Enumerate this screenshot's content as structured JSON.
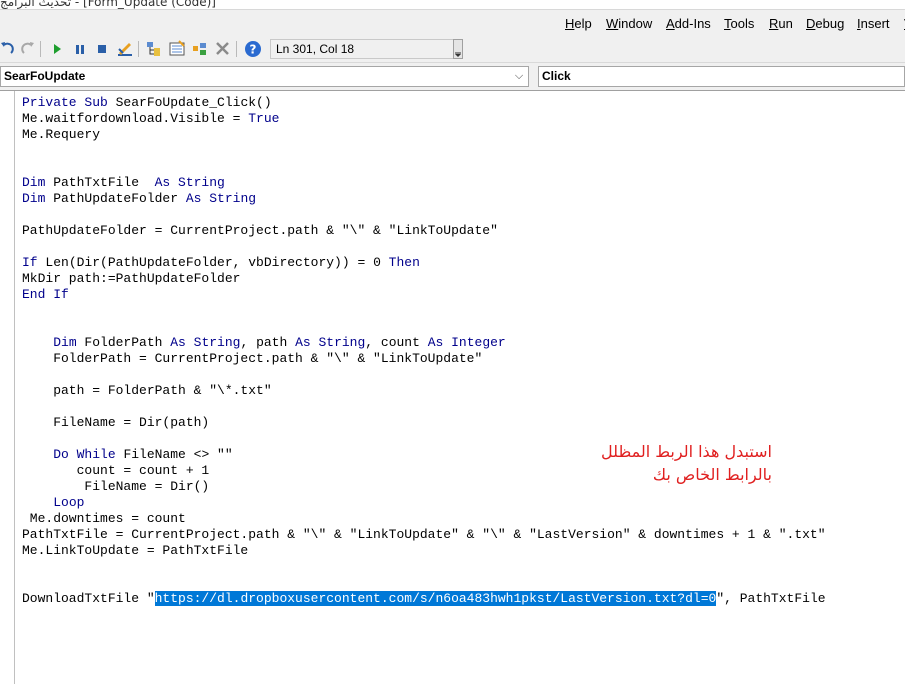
{
  "window": {
    "title": "تحديث البرامج - [Form_Update (Code)]"
  },
  "menu": {
    "items": [
      {
        "label": "Help",
        "accel": "H"
      },
      {
        "label": "Window",
        "accel": "W"
      },
      {
        "label": "Add-Ins",
        "accel": "A"
      },
      {
        "label": "Tools",
        "accel": "T"
      },
      {
        "label": "Run",
        "accel": "R"
      },
      {
        "label": "Debug",
        "accel": "D"
      },
      {
        "label": "Insert",
        "accel": "I"
      },
      {
        "label": "View",
        "accel": "V"
      }
    ]
  },
  "toolbar": {
    "position_text": "Ln 301, Col 18",
    "icons": [
      "undo-icon",
      "redo-icon",
      "run-icon",
      "break-icon",
      "reset-icon",
      "design-mode-icon",
      "project-explorer-icon",
      "properties-icon",
      "object-browser-icon",
      "toolbox-icon",
      "help-icon"
    ]
  },
  "combos": {
    "object_value": "SearFoUpdate",
    "procedure_value": "Click"
  },
  "code": {
    "url": "https://dl.dropboxusercontent.com/s/n6oa483hwh1pkst/LastVersion.txt?dl=0",
    "lines": [
      [
        [
          "k",
          "Private Sub"
        ],
        [
          "t",
          " SearFoUpdate_Click()"
        ]
      ],
      [
        [
          "t",
          "Me.waitfordownload.Visible = "
        ],
        [
          "k",
          "True"
        ]
      ],
      [
        [
          "t",
          "Me.Requery"
        ]
      ],
      [],
      [],
      [
        [
          "k",
          "Dim"
        ],
        [
          "t",
          " PathTxtFile  "
        ],
        [
          "k",
          "As String"
        ]
      ],
      [
        [
          "k",
          "Dim"
        ],
        [
          "t",
          " PathUpdateFolder "
        ],
        [
          "k",
          "As String"
        ]
      ],
      [],
      [
        [
          "t",
          "PathUpdateFolder = CurrentProject.path & \"\\\" & \"LinkToUpdate\""
        ]
      ],
      [],
      [
        [
          "k",
          "If"
        ],
        [
          "t",
          " Len(Dir(PathUpdateFolder, vbDirectory)) = 0 "
        ],
        [
          "k",
          "Then"
        ]
      ],
      [
        [
          "t",
          "MkDir path:=PathUpdateFolder"
        ]
      ],
      [
        [
          "k",
          "End If"
        ]
      ],
      [],
      [],
      [
        [
          "t",
          "    "
        ],
        [
          "k",
          "Dim"
        ],
        [
          "t",
          " FolderPath "
        ],
        [
          "k",
          "As String"
        ],
        [
          "t",
          ", path "
        ],
        [
          "k",
          "As String"
        ],
        [
          "t",
          ", count "
        ],
        [
          "k",
          "As Integer"
        ]
      ],
      [
        [
          "t",
          "    FolderPath = CurrentProject.path & \"\\\" & \"LinkToUpdate\""
        ]
      ],
      [],
      [
        [
          "t",
          "    path = FolderPath & \"\\*.txt\""
        ]
      ],
      [],
      [
        [
          "t",
          "    FileName = Dir(path)"
        ]
      ],
      [],
      [
        [
          "t",
          "    "
        ],
        [
          "k",
          "Do While"
        ],
        [
          "t",
          " FileName <> \"\""
        ]
      ],
      [
        [
          "t",
          "       count = count + 1"
        ]
      ],
      [
        [
          "t",
          "        FileName = Dir()"
        ]
      ],
      [
        [
          "t",
          "    "
        ],
        [
          "k",
          "Loop"
        ]
      ],
      [
        [
          "t",
          " Me.downtimes = count"
        ]
      ],
      [
        [
          "t",
          "PathTxtFile = CurrentProject.path & \"\\\" & \"LinkToUpdate\" & \"\\\" & \"LastVersion\" & downtimes + 1 & \".txt\""
        ]
      ],
      [
        [
          "t",
          "Me.LinkToUpdate = PathTxtFile"
        ]
      ],
      [],
      [],
      [
        [
          "t",
          "DownloadTxtFile \""
        ],
        [
          "s",
          "https://dl.dropboxusercontent.com/s/n6oa483hwh1pkst/LastVersion.txt?dl=0"
        ],
        [
          "t",
          "\", PathTxtFile"
        ]
      ]
    ]
  },
  "annotation": {
    "color": "#e02020",
    "line1": "استبدل هذا الربط المظلل",
    "line2": "بالرابط الخاص بك"
  },
  "colors": {
    "keyword": "#00008b",
    "selection": "#0078d7",
    "chrome": "#f0f0f0"
  }
}
